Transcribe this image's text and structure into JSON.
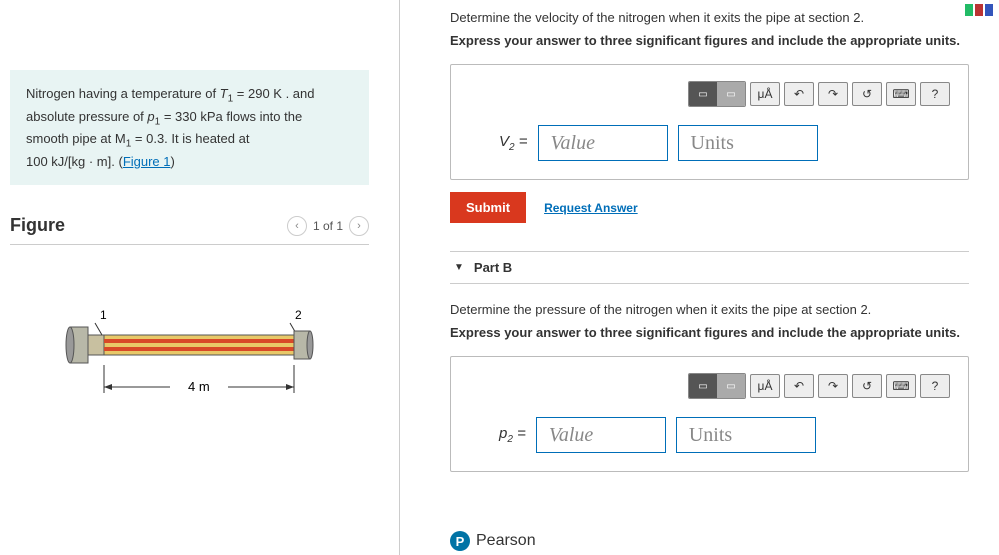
{
  "problem": {
    "line1a": "Nitrogen having a temperature of ",
    "T1_sym": "T",
    "T1_sub": "1",
    "T1_eq": " = 290  K . and",
    "line2a": "absolute pressure of ",
    "p1_sym": "p",
    "p1_sub": "1",
    "p1_eq": " = 330  kPa flows into the",
    "line3a": "smooth pipe at ",
    "M1_sym": "M",
    "M1_sub": "1",
    "M1_eq": " = 0.3. It is heated at",
    "line4": "100 kJ/[kg · m]. (",
    "fig_link": "Figure 1",
    "line4b": ")"
  },
  "figure": {
    "title": "Figure",
    "pager": "1 of 1",
    "label1": "1",
    "label2": "2",
    "length": "4 m"
  },
  "partA": {
    "question": "Determine the velocity of the nitrogen when it exits the pipe at section 2.",
    "instruct": "Express your answer to three significant figures and include the appropriate units.",
    "var_html": "V",
    "var_sub": "2",
    "eq": " = ",
    "value_ph": "Value",
    "units_ph": "Units",
    "mu": "μÅ",
    "help": "?",
    "submit": "Submit",
    "request": "Request Answer"
  },
  "partB": {
    "header": "Part B",
    "question": "Determine the pressure of the nitrogen when it exits the pipe at section 2.",
    "instruct": "Express your answer to three significant figures and include the appropriate units.",
    "var_html": "p",
    "var_sub": "2",
    "eq": " = ",
    "value_ph": "Value",
    "units_ph": "Units",
    "mu": "μÅ",
    "help": "?"
  },
  "footer": {
    "brand": "Pearson",
    "logo": "P"
  }
}
